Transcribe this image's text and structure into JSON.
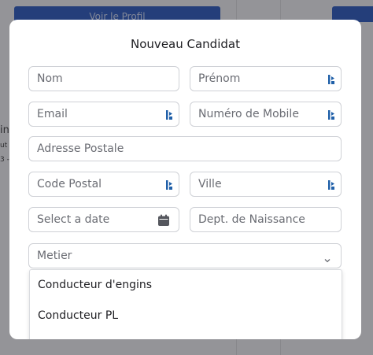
{
  "background": {
    "profile_button_label": "Voir le Profil",
    "side_letters": [
      "in",
      "ut",
      "3 -"
    ]
  },
  "modal": {
    "title": "Nouveau Candidat",
    "fields": {
      "nom": {
        "placeholder": "Nom"
      },
      "prenom": {
        "placeholder": "Prénom"
      },
      "email": {
        "placeholder": "Email"
      },
      "mobile": {
        "placeholder": "Numéro de Mobile"
      },
      "adresse": {
        "placeholder": "Adresse Postale"
      },
      "code_postal": {
        "placeholder": "Code Postal"
      },
      "ville": {
        "placeholder": "Ville"
      },
      "date": {
        "placeholder": "Select a date"
      },
      "dept_naissance": {
        "placeholder": "Dept. de Naissance"
      },
      "metier": {
        "placeholder": "Metier"
      }
    },
    "metier_options": [
      "Conducteur d'engins",
      "Conducteur PL"
    ]
  },
  "icons": {
    "field_indicator": "password-manager-icon",
    "date": "calendar-icon",
    "select": "chevron-down-icon"
  },
  "colors": {
    "accent_blue": "#2150b8",
    "indicator_blue": "#1f5fa8",
    "calendar_gray": "#55575e"
  }
}
